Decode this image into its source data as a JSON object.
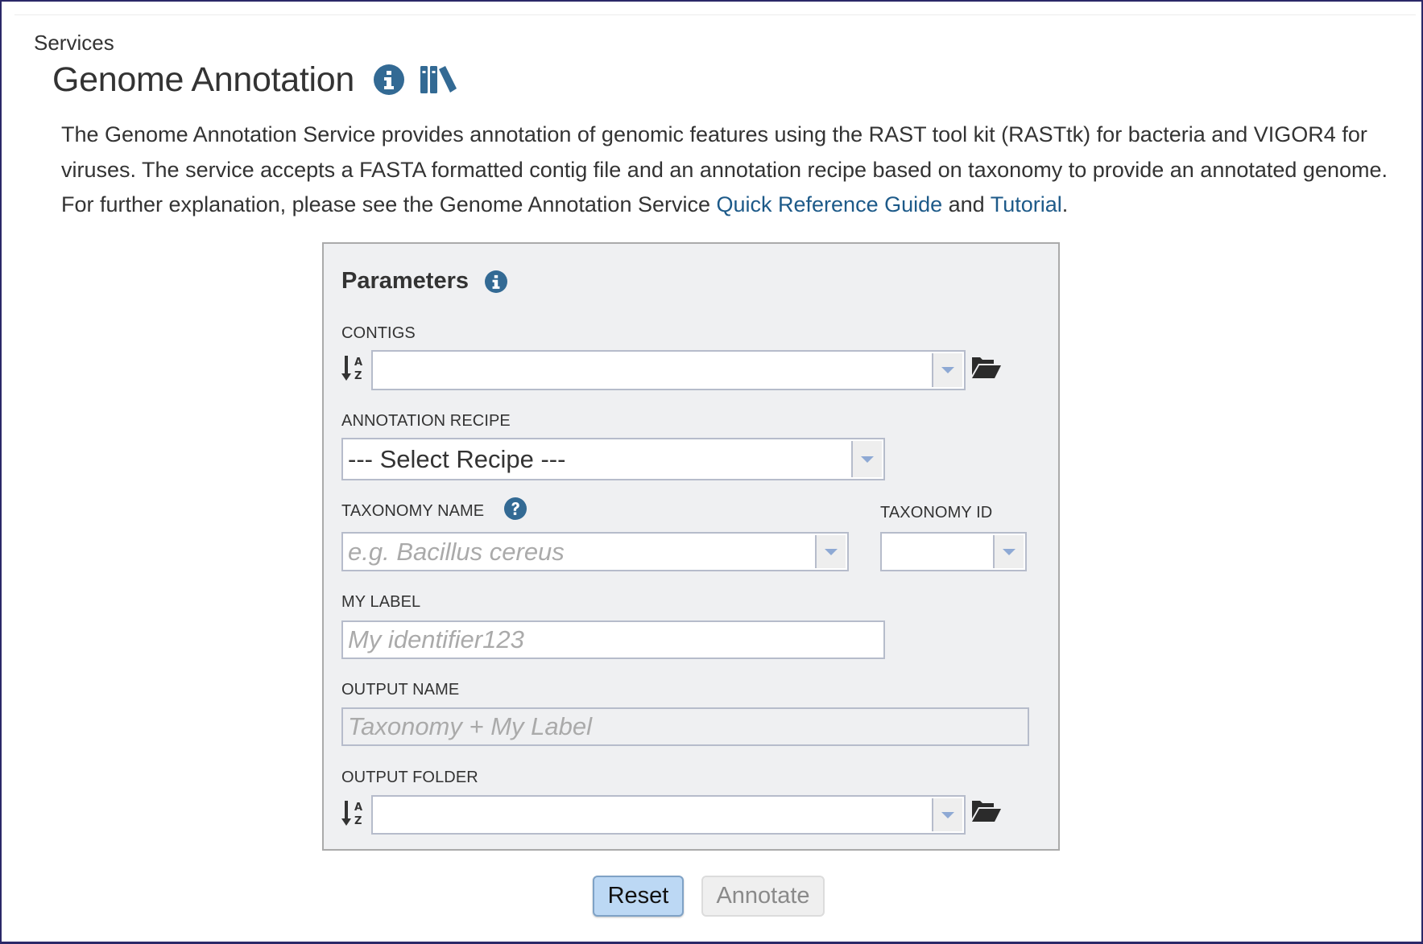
{
  "breadcrumb": "Services",
  "header": {
    "title": "Genome Annotation",
    "icons": [
      "info-icon",
      "books-icon"
    ]
  },
  "description": {
    "text_before": "The Genome Annotation Service provides annotation of genomic features using the RAST tool kit (RASTtk) for bacteria and VIGOR4 for viruses. The service accepts a FASTA formatted contig file and an annotation recipe based on taxonomy to provide an annotated genome. For further explanation, please see the Genome Annotation Service ",
    "link1": "Quick Reference Guide",
    "text_between": " and ",
    "link2": "Tutorial",
    "text_after": "."
  },
  "parameters": {
    "title": "Parameters",
    "contigs": {
      "label": "CONTIGS",
      "value": ""
    },
    "recipe": {
      "label": "ANNOTATION RECIPE",
      "value": "--- Select Recipe ---"
    },
    "taxonomy_name": {
      "label": "TAXONOMY NAME",
      "placeholder": "e.g. Bacillus cereus",
      "value": ""
    },
    "taxonomy_id": {
      "label": "TAXONOMY ID",
      "value": ""
    },
    "my_label": {
      "label": "MY LABEL",
      "placeholder": "My identifier123",
      "value": ""
    },
    "output_name": {
      "label": "OUTPUT NAME",
      "placeholder": "Taxonomy + My Label",
      "value": ""
    },
    "output_folder": {
      "label": "OUTPUT FOLDER",
      "value": ""
    }
  },
  "buttons": {
    "reset": "Reset",
    "annotate": "Annotate"
  },
  "colors": {
    "accent": "#336a94",
    "link": "#1d5a89",
    "frame": "#2b2868",
    "panel_bg": "#eff0f2"
  }
}
